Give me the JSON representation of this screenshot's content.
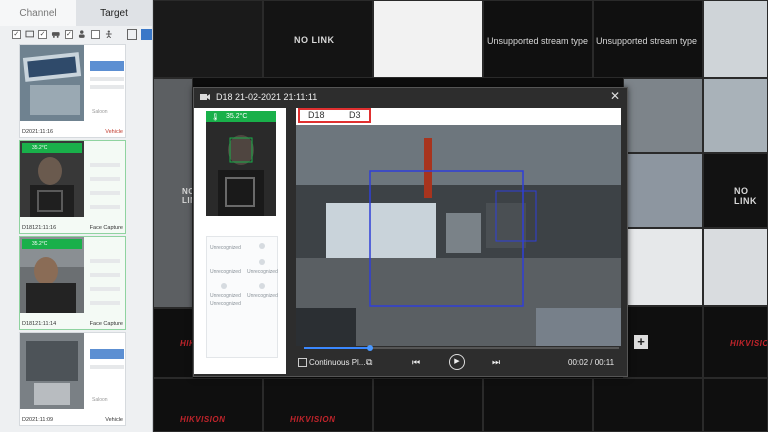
{
  "sidebar": {
    "tabs": [
      {
        "label": "Channel"
      },
      {
        "label": "Target"
      }
    ],
    "cards": [
      {
        "time": "D2021:11:16",
        "type": "Vehicle",
        "button": "",
        "status": "Saloon"
      },
      {
        "time": "D18121:11:16",
        "type": "Face Capture",
        "temp": "35.2°C"
      },
      {
        "time": "D18121:11:14",
        "type": "Face Capture",
        "temp": "35.2°C"
      },
      {
        "time": "D2021:11:09",
        "type": "Vehicle",
        "button": "",
        "status": "Saloon"
      }
    ]
  },
  "grid": {
    "nolink_1": "NO LINK",
    "nolink_2": "NO LINK",
    "nolink_3": "NO LINK",
    "unsupported_1": "Unsupported stream type",
    "unsupported_2": "Unsupported stream type",
    "brand": "HIKVISION",
    "add_icon": "plus-icon"
  },
  "dialog": {
    "title": "D18 21-02-2021 21:11:11",
    "temperature": "35.2°C",
    "tab_channel": "D18",
    "tab_target": "D3",
    "attributes": [
      "Unrecognized",
      "Unrecognized",
      "Unrecognized",
      "Unrecognized",
      "Unrecognized",
      "Unrecognized"
    ],
    "continuous_label": "Continuous Pl...",
    "time_display": "00:02 / 00:11",
    "progress_fraction": 0.21
  },
  "colors": {
    "accent": "#3a88ff",
    "face_green": "#19b04a",
    "highlight_red": "#e03030",
    "brand_red": "#c0242b"
  }
}
